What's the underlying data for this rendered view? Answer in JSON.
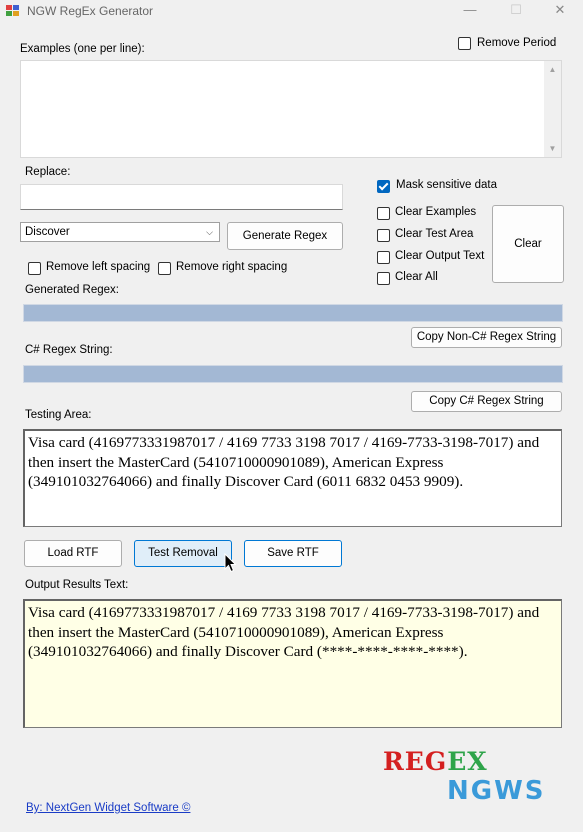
{
  "window": {
    "title": "NGW RegEx Generator",
    "minimize": "—",
    "maximize": "☐",
    "close": "✕"
  },
  "examples": {
    "label": "Examples (one per line):",
    "value": ""
  },
  "remove_period": {
    "label": "Remove Period",
    "checked": false
  },
  "replace": {
    "label": "Replace:",
    "value": ""
  },
  "mask_sensitive": {
    "label": "Mask sensitive data",
    "checked": true
  },
  "clear_options": [
    {
      "label": "Clear Examples",
      "checked": false
    },
    {
      "label": "Clear Test Area",
      "checked": false
    },
    {
      "label": "Clear Output Text",
      "checked": false
    },
    {
      "label": "Clear All",
      "checked": false
    }
  ],
  "clear_button": "Clear",
  "pattern_select": {
    "value": "Discover"
  },
  "generate_button": "Generate Regex",
  "remove_left_spacing": {
    "label": "Remove left spacing",
    "checked": false
  },
  "remove_right_spacing": {
    "label": "Remove right spacing",
    "checked": false
  },
  "generated_regex": {
    "label": "Generated Regex:",
    "value": ""
  },
  "copy_non_csharp_button": "Copy Non-C# Regex String",
  "csharp_regex": {
    "label": "C# Regex String:",
    "value": ""
  },
  "copy_csharp_button": "Copy C# Regex String",
  "testing_area": {
    "label": "Testing Area:",
    "text": "Visa card (4169773331987017 / 4169 7733 3198 7017 / 4169-7733-3198-7017) and then insert the MasterCard (5410710000901089), American Express (349101032764066) and finally Discover Card (6011 6832 0453 9909)."
  },
  "load_rtf_button": "Load RTF",
  "test_removal_button": "Test Removal",
  "save_rtf_button": "Save RTF",
  "output": {
    "label": "Output Results Text:",
    "text": "Visa card (4169773331987017 / 4169 7733 3198 7017 / 4169-7733-3198-7017) and then insert the MasterCard (5410710000901089), American Express (349101032764066) and finally Discover Card (****-****-****-****)."
  },
  "logo": {
    "line1_part1": "REG",
    "line1_part2": "EX",
    "line2": "NGWS",
    "colors": {
      "red": "#d42020",
      "green": "#2ea44a",
      "blue": "#3a9ad9"
    }
  },
  "footer_link": "By: NextGen Widget Software  ©"
}
